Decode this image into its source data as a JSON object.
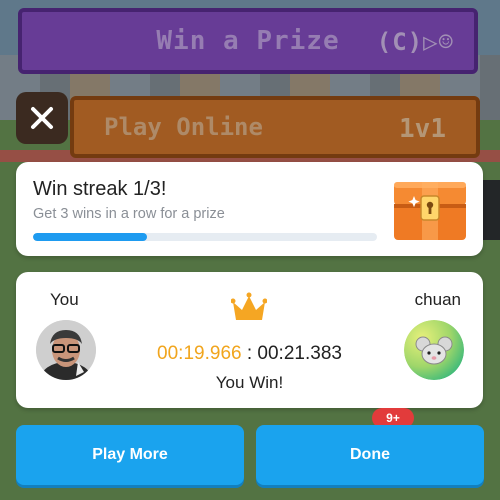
{
  "background": {
    "prize_banner_label": "Win a Prize",
    "prize_banner_tag": "(C)▷☺",
    "online_banner_label": "Play Online",
    "online_banner_mode": "1v1"
  },
  "close": {
    "icon": "close-icon"
  },
  "streak": {
    "title": "Win streak 1/3!",
    "subtitle": "Get 3 wins in a row for a prize",
    "progress": 0.33,
    "icon": "treasure-chest-icon"
  },
  "result": {
    "player_name": "You",
    "opponent_name": "chuan",
    "player_time": "00:19.966",
    "separator": " : ",
    "opponent_time": "00:21.383",
    "outcome": "You Win!",
    "winner_icon": "crown-icon"
  },
  "notification_badge": "9+",
  "buttons": {
    "play_more": "Play More",
    "done": "Done"
  },
  "colors": {
    "accent_blue": "#1aa3ee",
    "player_time": "#f1a51d",
    "crown": "#f5a623",
    "chest": "#f07a2a"
  }
}
